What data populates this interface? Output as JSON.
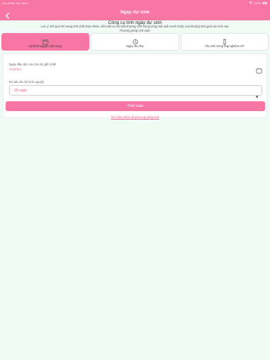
{
  "status_bar": {
    "time": "10:15 AM",
    "date": "Sun Jan 7",
    "battery": "100%"
  },
  "nav": {
    "title": "Ngày dự sinh",
    "back_icon": "chevron-left-icon"
  },
  "header": {
    "title": "Công cụ tính ngày dự sinh",
    "note": "Lưu ý, kết quả chỉ mang tính chất tham khảo. Nếu bất cứ mẹ bầu thường sinh trong vòng một tuần trước hoặc sau khoảng thời gian dự sinh này.",
    "method_label": "Phương pháp tính toán"
  },
  "tabs": [
    {
      "label": "Kỳ kinh nguyệt cuối cùng",
      "icon": "calendar-icon",
      "active": true
    },
    {
      "label": "Ngày thụ thai",
      "icon": "cycle-icon",
      "active": false
    },
    {
      "label": "Thụ tinh trong ống nghiệm IVF",
      "icon": "test-tube-icon",
      "active": false
    }
  ],
  "form": {
    "date_label": "Ngày đầu tiên của chu kỳ gần nhất",
    "date_value": "1/1/2024",
    "cycle_label": "Độ dài chu kỳ kinh nguyệt",
    "cycle_value": "28 ngày"
  },
  "actions": {
    "calculate": "Tính toán",
    "learn_more": "Tìm hiểu thêm về phương pháp tính"
  },
  "colors": {
    "accent": "#f776a3",
    "accent_text": "#f05d8f",
    "background": "#f1fbf6"
  }
}
